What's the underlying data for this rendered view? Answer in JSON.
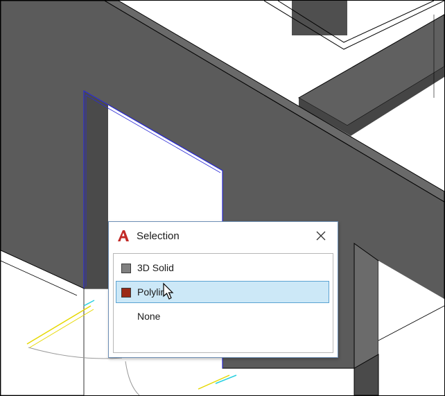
{
  "popup": {
    "title": "Selection",
    "app_icon": "autocad-a-icon",
    "close_icon": "close-icon",
    "accent": "#c22a27",
    "items": [
      {
        "label": "3D Solid",
        "swatch": "#808080",
        "selected": false
      },
      {
        "label": "Polyline",
        "swatch": "#9b2b17",
        "selected": true
      },
      {
        "label": "None",
        "swatch": null,
        "selected": false
      }
    ]
  },
  "scene": {
    "wall_color": "#5a5a5a",
    "highlight_color": "#2b2bd6",
    "cursor_icon": "arrow-cursor-icon"
  }
}
